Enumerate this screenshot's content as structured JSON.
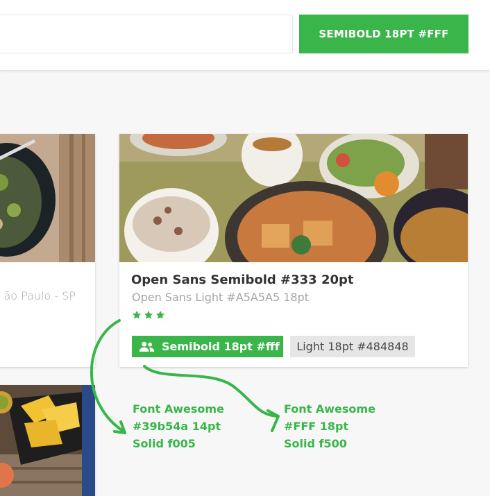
{
  "header": {
    "search_placeholder": "",
    "search_button_label": "SEMIBOLD 18PT #FFF"
  },
  "cards": {
    "left": {
      "address": "ão Paulo - SP"
    },
    "main": {
      "title": "Open Sans Semibold #333 20pt",
      "subtitle": "Open Sans Light #A5A5A5 18pt",
      "rating": 3,
      "guests_badge": "Semibold 18pt #fff",
      "light_badge": "Light 18pt #484848"
    }
  },
  "annotations": {
    "star_note": {
      "line1": "Font Awesome",
      "line2": "#39b54a 14pt",
      "line3": "Solid f005"
    },
    "users_note": {
      "line1": "Font Awesome",
      "line2": "#FFF 18pt",
      "line3": "Solid f500"
    }
  },
  "icons": {
    "star": "star-icon",
    "users": "users-icon",
    "arrow": "curved-arrow"
  },
  "colors": {
    "accent": "#39b54a",
    "title": "#333333",
    "subtitle": "#a5a5a5",
    "light_badge_text": "#484848",
    "light_badge_bg": "#e6e6e6"
  }
}
